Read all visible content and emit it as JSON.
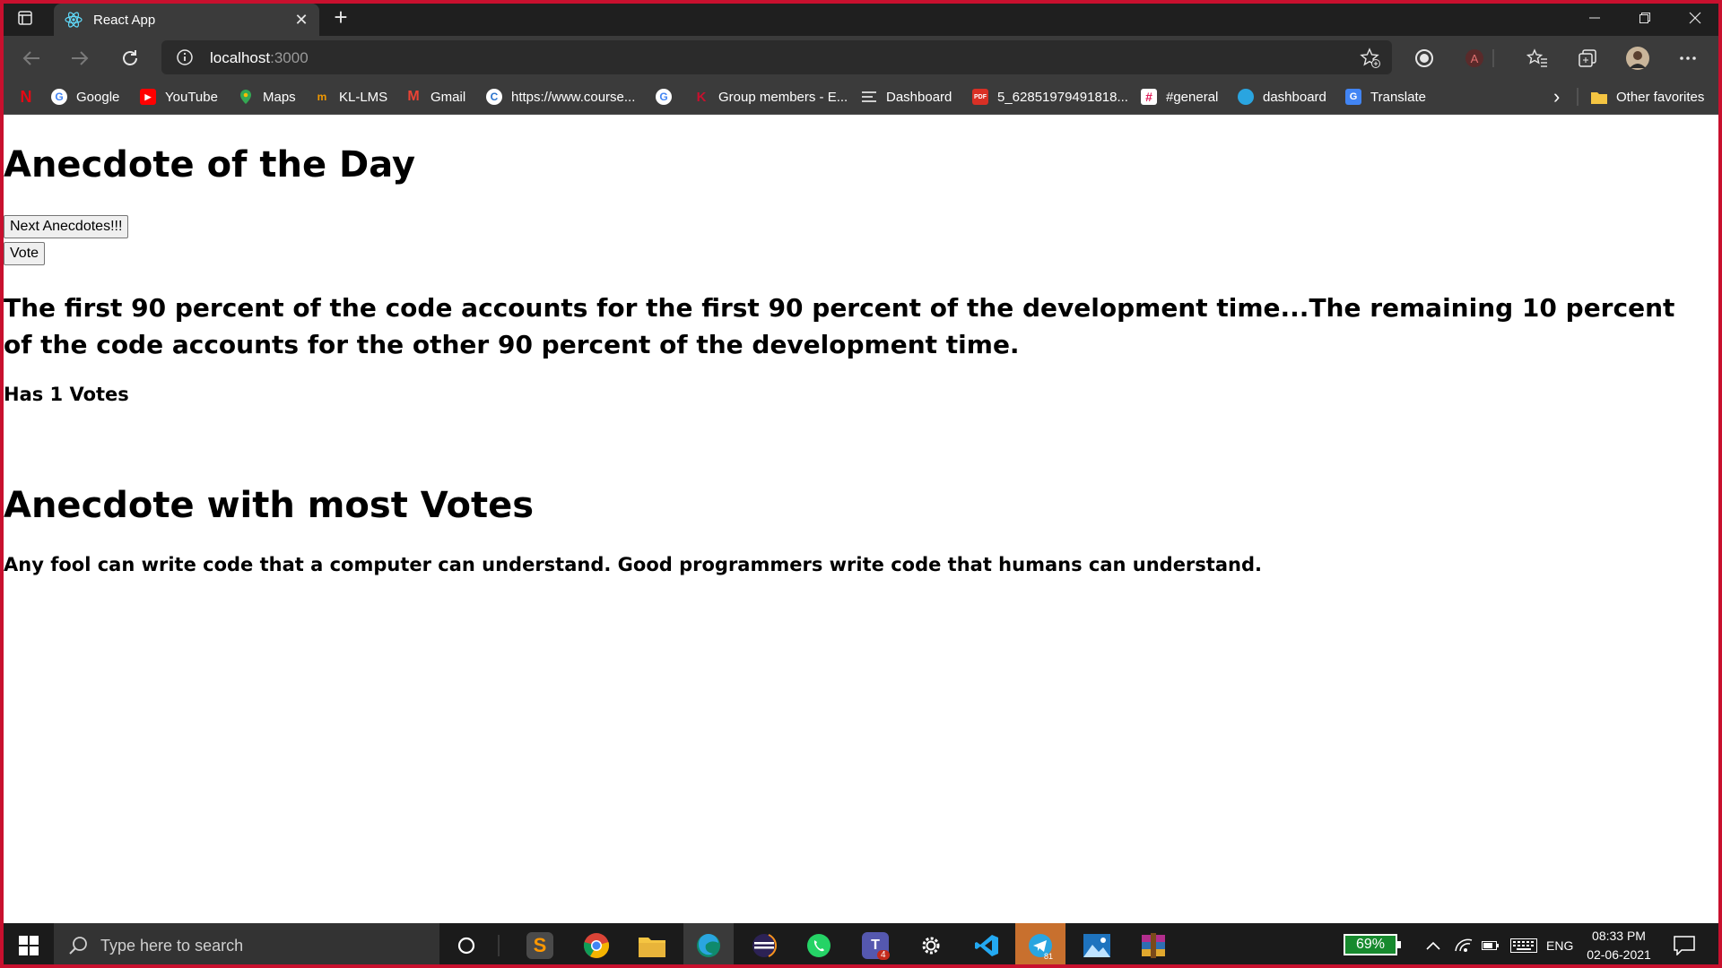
{
  "browser": {
    "tab_title": "React App",
    "tab_close": "✕",
    "new_tab": "+",
    "address": {
      "host": "localhost",
      "port": ":3000"
    }
  },
  "bookmarks": [
    {
      "label": "",
      "icon": "netflix-icon",
      "color": "#e50914"
    },
    {
      "label": "Google",
      "icon": "google-icon",
      "color": "#4285f4"
    },
    {
      "label": "YouTube",
      "icon": "youtube-icon",
      "color": "#ff0000"
    },
    {
      "label": "Maps",
      "icon": "maps-icon",
      "color": "#34a853"
    },
    {
      "label": "KL-LMS",
      "icon": "kl-lms-icon",
      "color": "#f29900"
    },
    {
      "label": "Gmail",
      "icon": "gmail-icon",
      "color": "#ea4335"
    },
    {
      "label": "https://www.course...",
      "icon": "coursera-icon",
      "color": "#2a73cc"
    },
    {
      "label": "",
      "icon": "google-icon",
      "color": "#4285f4"
    },
    {
      "label": "Group members - E...",
      "icon": "kl-icon",
      "color": "#c8102e"
    },
    {
      "label": "Dashboard",
      "icon": "dashboard-icon",
      "color": "#8a8a8a"
    },
    {
      "label": "5_62851979491818...",
      "icon": "pdf-icon",
      "color": "#d93025"
    },
    {
      "label": "#general",
      "icon": "slack-icon",
      "color": "#e01e5a"
    },
    {
      "label": "dashboard",
      "icon": "edge-icon",
      "color": "#2aa5e0"
    },
    {
      "label": "Translate",
      "icon": "translate-icon",
      "color": "#4285f4"
    }
  ],
  "bookmarks_more": "›",
  "other_favorites": "Other favorites",
  "page": {
    "heading1": "Anecdote of the Day",
    "next_button": "Next Anecdotes!!!",
    "vote_button": "Vote",
    "anecdote": "The first 90 percent of the code accounts for the first 90 percent of the development time...The remaining 10 percent of the code accounts for the other 90 percent of the development time.",
    "votes": "Has 1 Votes",
    "heading2": "Anecdote with most Votes",
    "most_voted": "Any fool can write code that a computer can understand. Good programmers write code that humans can understand."
  },
  "taskbar": {
    "search_placeholder": "Type here to search",
    "battery": "69%",
    "language": "ENG",
    "time": "08:33 PM",
    "date": "02-06-2021",
    "teams_badge": "4",
    "telegram_badge": "81"
  },
  "colors": {
    "accent_red": "#c8102e",
    "battery_green": "#178a2e"
  }
}
